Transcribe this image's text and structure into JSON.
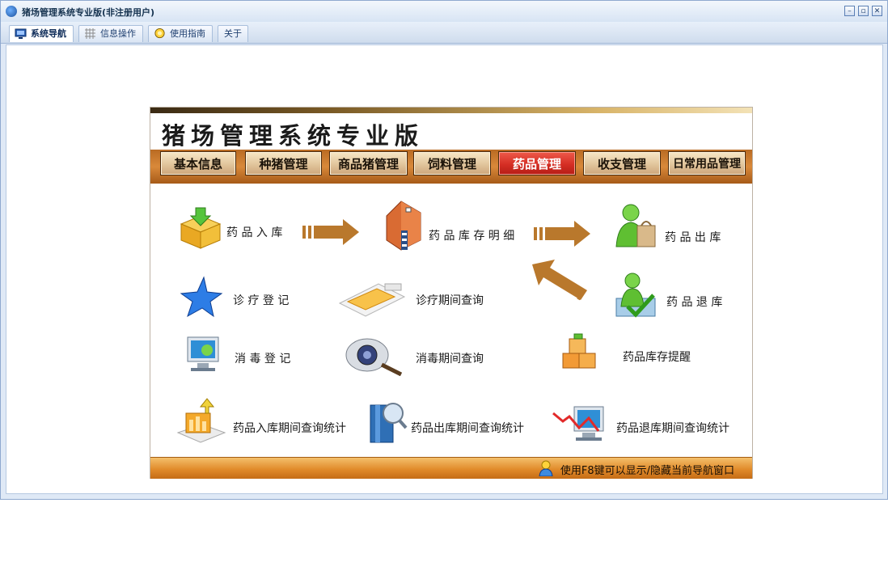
{
  "window": {
    "title": "猪场管理系统专业版(非注册用户)",
    "controls": {
      "minimize": "–",
      "restore": "▫",
      "close": "✕"
    }
  },
  "tabs": [
    {
      "label": "系统导航",
      "icon": "monitor-icon",
      "active": true
    },
    {
      "label": "信息操作",
      "icon": "grid-icon",
      "active": false
    },
    {
      "label": "使用指南",
      "icon": "help-icon",
      "active": false
    },
    {
      "label": "关于",
      "icon": "",
      "active": false
    }
  ],
  "panel": {
    "title": "猪场管理系统专业版",
    "menu": [
      {
        "label": "基本信息",
        "active": false
      },
      {
        "label": "种猪管理",
        "active": false
      },
      {
        "label": "商品猪管理",
        "active": false
      },
      {
        "label": "饲料管理",
        "active": false
      },
      {
        "label": "药品管理",
        "active": true
      },
      {
        "label": "收支管理",
        "active": false
      },
      {
        "label": "日常用品管理",
        "active": false
      }
    ],
    "items": {
      "drug_in": "药 品 入 库",
      "drug_stock_detail": "药 品 库 存 明 细",
      "drug_out": "药 品 出 库",
      "treatment_register": "诊 疗 登 记",
      "treatment_query": "诊疗期间查询",
      "drug_return": "药 品 退 库",
      "disinfect_register": "消 毒 登 记",
      "disinfect_query": "消毒期间查询",
      "stock_alert": "药品库存提醒",
      "in_stats": "药品入库期间查询统计",
      "out_stats": "药品出库期间查询统计",
      "return_stats": "药品退库期间查询统计"
    },
    "status": "使用F8键可以显示/隐藏当前导航窗口"
  },
  "colors": {
    "menu_strip": "#d9893a",
    "active_menu": "#d52e24",
    "arrow": "#b9782c",
    "status_strip": "#e18b2b"
  }
}
